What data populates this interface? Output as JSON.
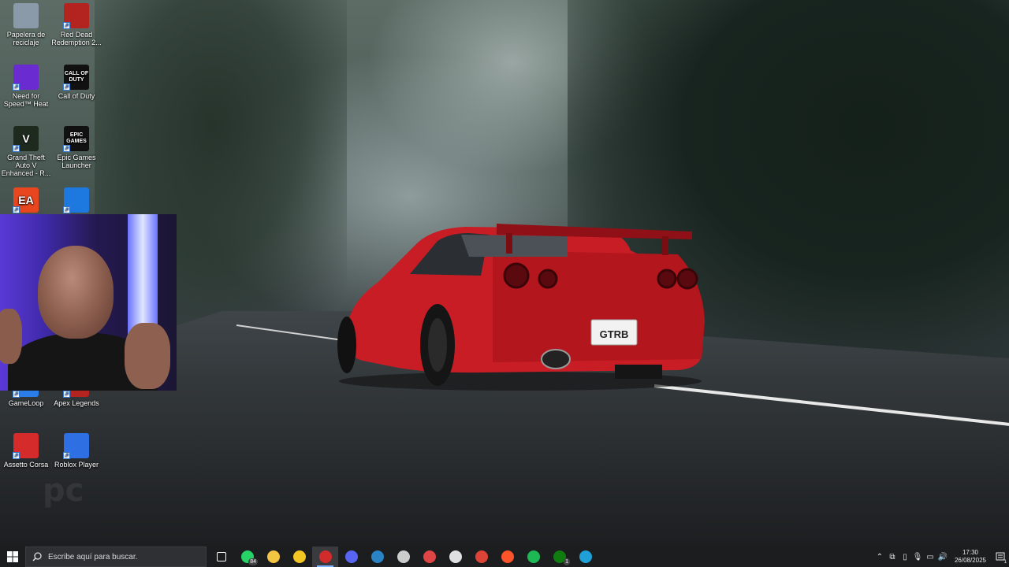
{
  "desktop": {
    "icons": [
      {
        "label": "Papelera de reciclaje",
        "icon": "recycle-bin-icon",
        "color": "#8a9aa8"
      },
      {
        "label": "Red Dead Redemption 2...",
        "icon": "rdr2-icon",
        "color": "#b3231f"
      },
      {
        "label": "Need for Speed™ Heat",
        "icon": "nfs-heat-icon",
        "color": "#6a2bd1"
      },
      {
        "label": "Call of Duty",
        "icon": "call-of-duty-icon",
        "color": "#111111",
        "glyph": "CALL OF DUTY"
      },
      {
        "label": "Grand Theft Auto V Enhanced - R...",
        "icon": "gta-v-icon",
        "color": "#1f2a1f",
        "glyph": "V"
      },
      {
        "label": "Epic Games Launcher",
        "icon": "epic-games-icon",
        "color": "#111111",
        "glyph": "EPIC GAMES"
      },
      {
        "label": "",
        "icon": "ea-app-icon",
        "color": "#e8461f",
        "glyph": "EA"
      },
      {
        "label": "",
        "icon": "battle-net-icon",
        "color": "#1d78e0"
      },
      {
        "label": "GameLoop",
        "icon": "gameloop-icon",
        "color": "#2b7de9"
      },
      {
        "label": "Apex Legends",
        "icon": "apex-legends-icon",
        "color": "#b3231f"
      },
      {
        "label": "Assetto Corsa",
        "icon": "assetto-corsa-icon",
        "color": "#d62b2b"
      },
      {
        "label": "Roblox Player",
        "icon": "roblox-icon",
        "color": "#2f6fe4"
      }
    ],
    "plate_text": "GTRB"
  },
  "taskbar": {
    "search_placeholder": "Escribe aquí para buscar.",
    "apps": [
      {
        "name": "task-view-icon",
        "color": "#ffffff"
      },
      {
        "name": "whatsapp-icon",
        "color": "#25d366",
        "badge": "84"
      },
      {
        "name": "file-explorer-icon",
        "color": "#f4c542"
      },
      {
        "name": "microsoft-store-icon",
        "color": "#f3c623"
      },
      {
        "name": "roblox-studio-icon",
        "color": "#d12b2b",
        "active": true
      },
      {
        "name": "discord-icon",
        "color": "#5865f2"
      },
      {
        "name": "steam-icon",
        "color": "#2a83c4"
      },
      {
        "name": "g-hub-icon",
        "color": "#cccccc"
      },
      {
        "name": "davinci-icon",
        "color": "#e04545"
      },
      {
        "name": "obs-icon",
        "color": "#e0e0e0"
      },
      {
        "name": "chrome-icon",
        "color": "#db4437"
      },
      {
        "name": "brave-icon",
        "color": "#fb542b"
      },
      {
        "name": "spotify-icon",
        "color": "#1db954"
      },
      {
        "name": "xbox-icon",
        "color": "#107c10",
        "badge": "1"
      },
      {
        "name": "edge-icon",
        "color": "#1fa1d8"
      }
    ],
    "clock_time": "17:30",
    "clock_date": "26/08/2025",
    "notification_count": "1"
  }
}
